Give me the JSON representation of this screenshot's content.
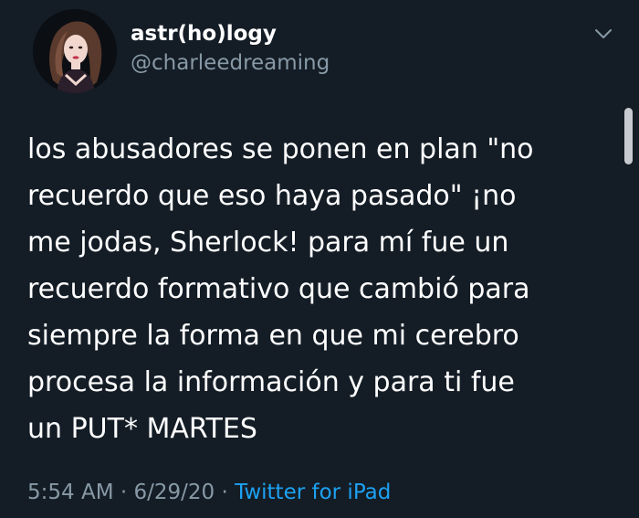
{
  "author": {
    "display_name": "astr(ho)logy",
    "handle": "@charleedreaming",
    "avatar_icon": "profile-avatar"
  },
  "menu": {
    "icon": "chevron-down-icon"
  },
  "tweet": {
    "lines": [
      "los abusadores se ponen en plan \"no",
      "recuerdo que eso haya pasado\" ¡no",
      "me jodas, Sherlock! para mí fue un",
      "recuerdo formativo que cambió para",
      "siempre la forma en que mi cerebro",
      "procesa la información y para ti fue",
      "un PUT* MARTES"
    ]
  },
  "meta": {
    "time": "5:54 AM",
    "separator": "·",
    "date": "6/29/20",
    "source": "Twitter for iPad"
  },
  "colors": {
    "background": "#141d26",
    "text": "#ffffff",
    "secondary": "#8899a6",
    "link": "#1da1f2"
  }
}
